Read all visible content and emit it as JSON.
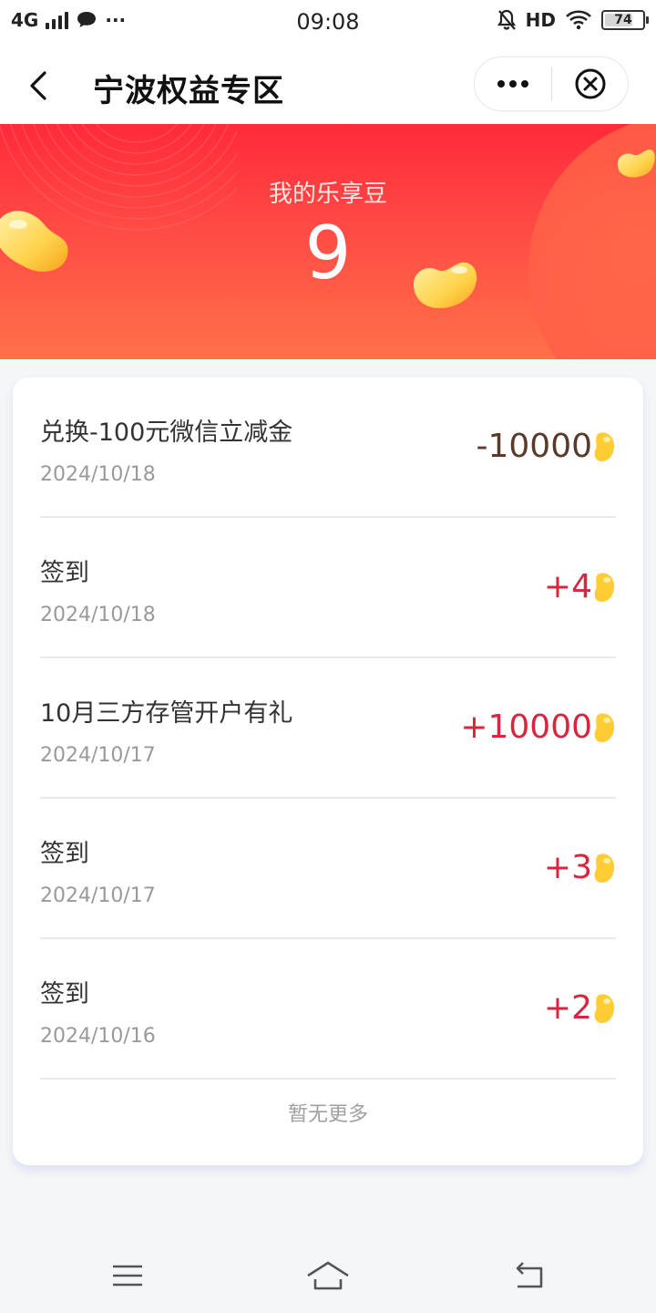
{
  "status_bar": {
    "network": "4G",
    "more": "···",
    "time": "09:08",
    "hd": "HD",
    "battery": "74",
    "battery_level_percent": 74
  },
  "nav": {
    "title": "宁波权益专区"
  },
  "banner": {
    "label": "我的乐享豆",
    "value": "9"
  },
  "records": [
    {
      "title": "兑换-100元微信立减金",
      "date": "2024/10/18",
      "amount": "-10000",
      "sign": "neg"
    },
    {
      "title": "签到",
      "date": "2024/10/18",
      "amount": "+4",
      "sign": "pos"
    },
    {
      "title": "10月三方存管开户有礼",
      "date": "2024/10/17",
      "amount": "+10000",
      "sign": "pos"
    },
    {
      "title": "签到",
      "date": "2024/10/17",
      "amount": "+3",
      "sign": "pos"
    },
    {
      "title": "签到",
      "date": "2024/10/16",
      "amount": "+2",
      "sign": "pos"
    }
  ],
  "footer": {
    "no_more": "暂无更多"
  },
  "colors": {
    "positive": "#d9263e",
    "negative": "#5a3a2a",
    "banner_top": "#ff2a3a",
    "banner_bottom": "#ff7148"
  },
  "icons": {
    "back": "chevron-left-icon",
    "more": "more-dots-icon",
    "close": "close-circle-icon",
    "bean": "bean-icon",
    "menu": "menu-icon",
    "home": "home-icon",
    "return": "return-icon"
  }
}
